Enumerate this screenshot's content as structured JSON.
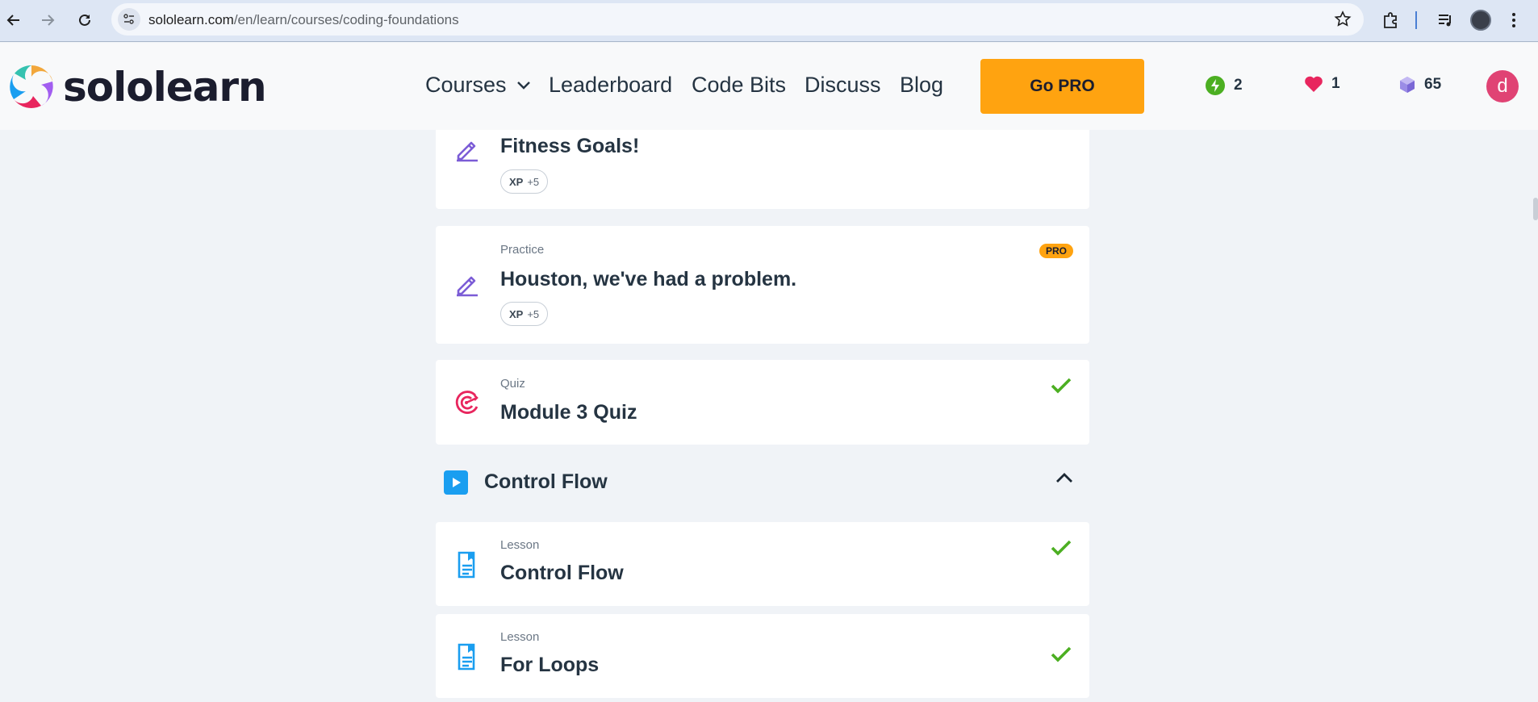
{
  "browser": {
    "url_host": "sololearn.com",
    "url_path": "/en/learn/courses/coding-foundations"
  },
  "header": {
    "logo_text": "sololearn",
    "nav": {
      "courses": "Courses",
      "leaderboard": "Leaderboard",
      "code_bits": "Code Bits",
      "discuss": "Discuss",
      "blog": "Blog"
    },
    "go_pro": "Go PRO",
    "streak": "2",
    "hearts": "1",
    "gems": "65",
    "avatar_letter": "d"
  },
  "cards": [
    {
      "type": "",
      "title": "Fitness Goals!",
      "xp_label": "XP",
      "xp_value": "+5",
      "icon": "practice-pencil-icon"
    },
    {
      "type": "Practice",
      "title": "Houston, we've had a problem.",
      "xp_label": "XP",
      "xp_value": "+5",
      "badge": "PRO",
      "icon": "practice-pencil-icon"
    },
    {
      "type": "Quiz",
      "title": "Module 3 Quiz",
      "icon": "quiz-target-icon",
      "completed": true
    }
  ],
  "section": {
    "title": "Control Flow",
    "items": [
      {
        "type": "Lesson",
        "title": "Control Flow",
        "icon": "lesson-doc-icon",
        "completed": true
      },
      {
        "type": "Lesson",
        "title": "For Loops",
        "icon": "lesson-doc-icon",
        "completed": true
      }
    ]
  },
  "colors": {
    "accent_orange": "#ffa310",
    "check_green": "#4caf22",
    "practice_purple": "#7b5cd6",
    "quiz_pink": "#e8265e",
    "lesson_blue": "#1a9ef0"
  }
}
